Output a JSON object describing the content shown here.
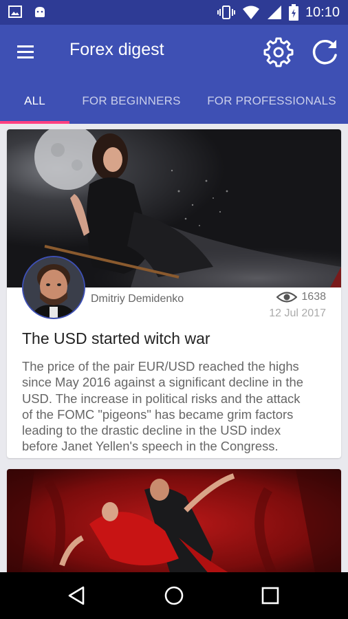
{
  "status_bar": {
    "time": "10:10",
    "icons": [
      "image-icon",
      "android-icon",
      "vibrate-icon",
      "wifi-icon",
      "signal-icon",
      "battery-charging-icon"
    ]
  },
  "app_bar": {
    "title": "Forex digest",
    "icons": [
      "menu-icon",
      "settings-gear-icon",
      "refresh-icon"
    ],
    "color": "#3e50b4"
  },
  "tabs": [
    {
      "label": "ALL",
      "active": true
    },
    {
      "label": "FOR BEGINNERS",
      "active": false
    },
    {
      "label": "FOR PROFESSIONALS",
      "active": false
    }
  ],
  "accent_color": "#ff4081",
  "articles": [
    {
      "author": "Dmitriy Demidenko",
      "views": "1638",
      "date": "12 Jul 2017",
      "title": "The USD started witch war",
      "excerpt_lines": [
        "The price of the pair EUR/USD reached the highs",
        "since May 2016 against a significant decline in the",
        "USD. The increase in political risks and the attack",
        "of the FOMC \"pigeons\" has became grim factors",
        "leading to the drastic decline in the USD index",
        "before Janet Yellen's speech in the Congress."
      ]
    }
  ],
  "nav_bar": {
    "icons": [
      "back-icon",
      "home-icon",
      "recents-icon"
    ]
  }
}
